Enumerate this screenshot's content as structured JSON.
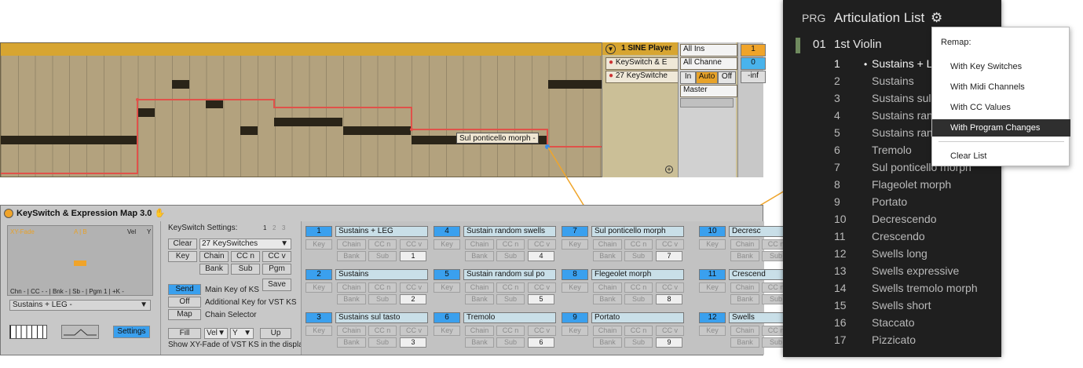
{
  "piano_roll": {
    "hover_label": "Sul ponticello morph -"
  },
  "device_chain": {
    "track_name": "1 SINE Player",
    "devices": [
      "KeySwitch & E",
      "27 KeySwitche"
    ],
    "input": "All Ins",
    "channel": "All Channe",
    "monitor": [
      "In",
      "Auto",
      "Off"
    ],
    "output": "Master",
    "value1": "1",
    "value2": "0",
    "value3": "-inf"
  },
  "device": {
    "title": "KeySwitch & Expression Map 3.0",
    "xy_labels": [
      "XY-Fade",
      "A | B",
      "Vel",
      "Y"
    ],
    "xy_footer": "Chn - | CC - - | Bnk - | Sb - | Pgm 1 | +K -",
    "articulation_select": "Sustains + LEG -",
    "settings_button": "Settings",
    "ks_settings_title": "KeySwitch Settings:",
    "pages": [
      "1",
      "2",
      "3"
    ],
    "clear": "Clear",
    "ks_count": "27 KeySwitches",
    "row_buttons": [
      "Key",
      "Chain",
      "CC n",
      "CC v"
    ],
    "row_buttons2": [
      "Bank",
      "Sub",
      "Pgm"
    ],
    "save": "Save",
    "send": "Send",
    "send_label": "Main Key of KS",
    "off": "Off",
    "off_label": "Additional Key for VST KS",
    "map": "Map",
    "map_label": "Chain Selector",
    "fill": "Fill",
    "fill_vel": "Vel",
    "fill_y": "Y",
    "up": "Up",
    "footer_text": "Show XY-Fade of VST KS in the display",
    "slot_labels": [
      "Key",
      "Chain",
      "CC n",
      "CC v",
      "Bank",
      "Sub"
    ],
    "slots": [
      {
        "num": "1",
        "name": "Sustains + LEG",
        "val": "1"
      },
      {
        "num": "2",
        "name": "Sustains",
        "val": "2"
      },
      {
        "num": "3",
        "name": "Sustains sul tasto",
        "val": "3"
      },
      {
        "num": "4",
        "name": "Sustain random swells",
        "val": "4"
      },
      {
        "num": "5",
        "name": "Sustain random sul po",
        "val": "5"
      },
      {
        "num": "6",
        "name": "Tremolo",
        "val": "6"
      },
      {
        "num": "7",
        "name": "Sul ponticello morph",
        "val": "7"
      },
      {
        "num": "8",
        "name": "Flegeolet morph",
        "val": "8"
      },
      {
        "num": "9",
        "name": "Portato",
        "val": "9"
      },
      {
        "num": "10",
        "name": "Decresc",
        "val": ""
      },
      {
        "num": "11",
        "name": "Crescend",
        "val": ""
      },
      {
        "num": "12",
        "name": "Swells",
        "val": ""
      }
    ]
  },
  "articulation_panel": {
    "prg_label": "PRG",
    "title": "Articulation List",
    "instrument_num": "01",
    "instrument": "1st Violin",
    "items": [
      {
        "n": "1",
        "name": "Sustains + LEG"
      },
      {
        "n": "2",
        "name": "Sustains"
      },
      {
        "n": "3",
        "name": "Sustains sul tasto"
      },
      {
        "n": "4",
        "name": "Sustains random swells"
      },
      {
        "n": "5",
        "name": "Sustains random sul po"
      },
      {
        "n": "6",
        "name": "Tremolo"
      },
      {
        "n": "7",
        "name": "Sul ponticello morph"
      },
      {
        "n": "8",
        "name": "Flageolet morph"
      },
      {
        "n": "9",
        "name": "Portato"
      },
      {
        "n": "10",
        "name": "Decrescendo"
      },
      {
        "n": "11",
        "name": "Crescendo"
      },
      {
        "n": "12",
        "name": "Swells long"
      },
      {
        "n": "13",
        "name": "Swells expressive"
      },
      {
        "n": "14",
        "name": "Swells tremolo morph"
      },
      {
        "n": "15",
        "name": "Swells short"
      },
      {
        "n": "16",
        "name": "Staccato"
      },
      {
        "n": "17",
        "name": "Pizzicato"
      }
    ],
    "menu": {
      "title": "Remap:",
      "items": [
        "With Key Switches",
        "With Midi Channels",
        "With CC Values",
        "With Program Changes"
      ],
      "clear": "Clear List"
    }
  }
}
